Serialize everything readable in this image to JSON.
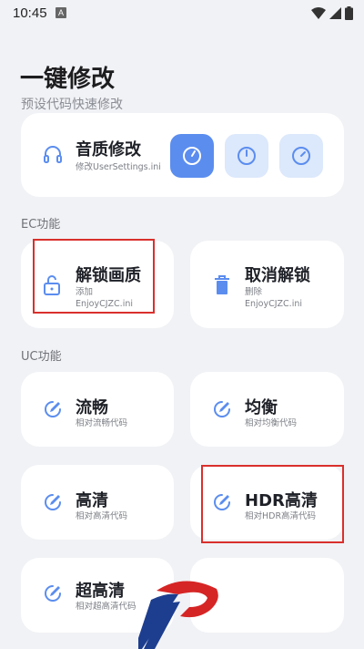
{
  "status_bar": {
    "time": "10:45",
    "a_badge": "A"
  },
  "header": {
    "title": "一键修改",
    "subtitle": "预设代码快速修改"
  },
  "sound_card": {
    "title": "音质修改",
    "desc": "修改UserSettings.ini"
  },
  "sections": {
    "ec": "EC功能",
    "uc": "UC功能"
  },
  "ec_cards": [
    {
      "title": "解锁画质",
      "desc_line1": "添加",
      "desc_line2": "EnjoyCJZC.ini"
    },
    {
      "title": "取消解锁",
      "desc_line1": "删除",
      "desc_line2": "EnjoyCJZC.ini"
    }
  ],
  "uc_cards": [
    {
      "title": "流畅",
      "desc": "相对流畅代码"
    },
    {
      "title": "均衡",
      "desc": "相对均衡代码"
    },
    {
      "title": "高清",
      "desc": "相对高清代码"
    },
    {
      "title": "HDR高清",
      "desc": "相对HDR高清代码"
    },
    {
      "title": "超高清",
      "desc": "相对超高清代码"
    }
  ],
  "colors": {
    "accent": "#5b8def",
    "accent_light": "#dce8fb",
    "highlight": "#d9302c"
  }
}
